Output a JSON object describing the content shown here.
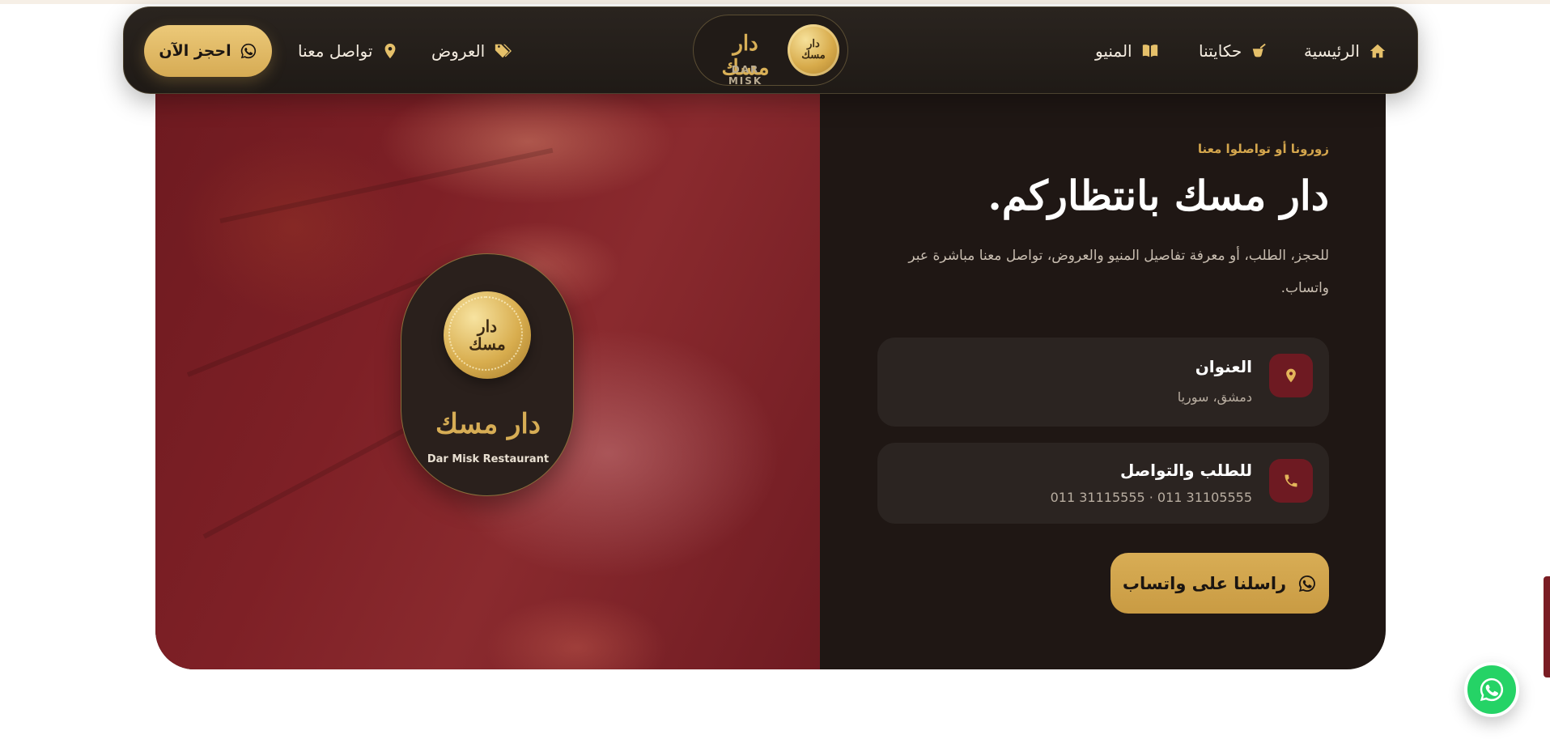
{
  "nav": {
    "home": "الرئيسية",
    "story": "حكايتنا",
    "menu": "المنيو",
    "offers": "العروض",
    "contact": "تواصل معنا",
    "book": "احجز الآن",
    "icons": {
      "home": "home-icon",
      "story": "cocktail-icon",
      "menu": "book-icon",
      "offers": "tags-icon",
      "contact": "map-pin-icon",
      "book": "whatsapp-icon"
    }
  },
  "brand": {
    "coin_text": "دار\nمسك",
    "name_ar": "دار مسك",
    "name_en": "DAR MISK"
  },
  "visual": {
    "badge_coin_text": "دار\nمسك",
    "badge_title": "دار مسك",
    "badge_sub": "Dar Misk Restaurant"
  },
  "contact": {
    "eyebrow": "زورونا أو تواصلوا معنا",
    "headline": "دار مسك بانتظاركم.",
    "description": "للحجز، الطلب، أو معرفة تفاصيل المنيو والعروض، تواصل معنا مباشرة عبر واتساب.",
    "address": {
      "label": "العنوان",
      "value": "دمشق، سوريا",
      "icon": "map-pin-icon"
    },
    "phone": {
      "label": "للطلب والتواصل",
      "value": "011 31115555 · 011 31105555",
      "icon": "phone-icon"
    },
    "whatsapp_button": "راسلنا على واتساب"
  },
  "colors": {
    "gold": "#d8ad55",
    "maroon": "#6e1a22",
    "dark": "#1f1714",
    "whatsapp": "#25d366"
  }
}
